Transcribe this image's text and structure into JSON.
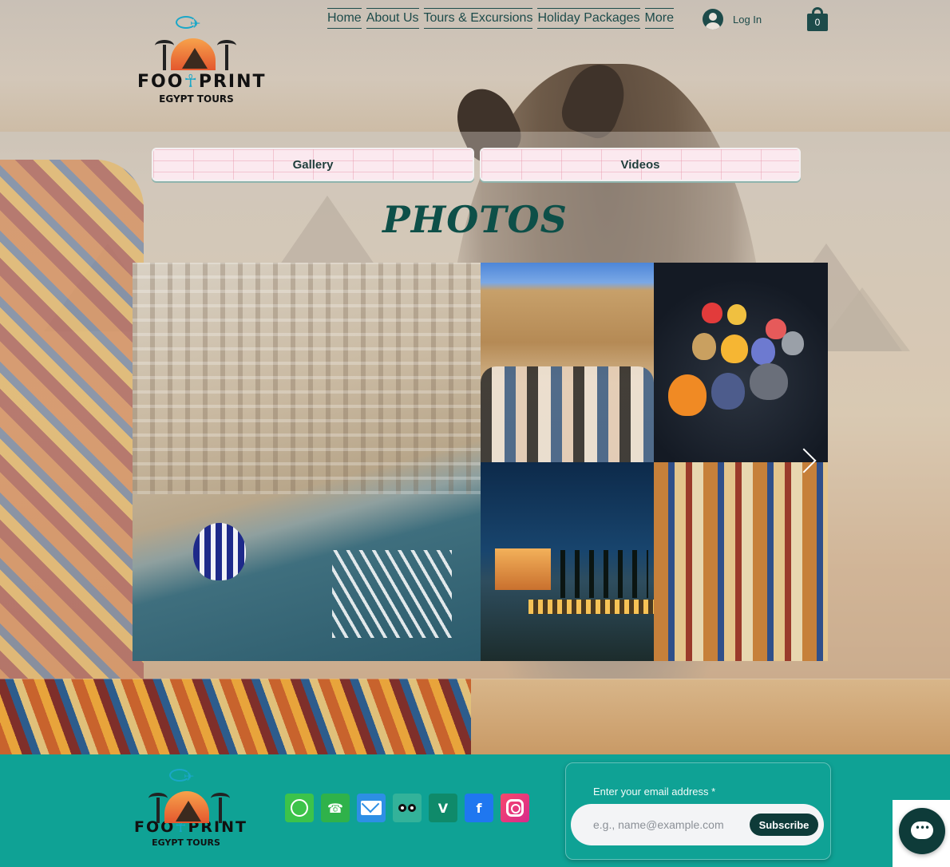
{
  "brand": {
    "name_pre": "FOO",
    "name_ankh": "☥",
    "name_post": "PRINT",
    "subtitle": "EGYPT TOURS"
  },
  "nav": {
    "items": [
      {
        "label": "Home"
      },
      {
        "label": "About Us"
      },
      {
        "label": "Tours & Excursions"
      },
      {
        "label": "Holiday Packages"
      },
      {
        "label": "More"
      }
    ],
    "login_label": "Log In",
    "cart_count": "0"
  },
  "main": {
    "tabs": [
      {
        "label": "Gallery"
      },
      {
        "label": "Videos"
      }
    ],
    "title": "PHOTOS"
  },
  "footer": {
    "brand": {
      "name_pre": "FOO",
      "name_ankh": "☥",
      "name_post": "PRINT",
      "subtitle": "EGYPT TOURS"
    },
    "social_icons": [
      "whatsapp-icon",
      "phone-icon",
      "mail-icon",
      "tripadvisor-icon",
      "viator-icon",
      "facebook-icon",
      "instagram-icon"
    ],
    "subscribe": {
      "label": "Enter your email address *",
      "placeholder": "e.g., name@example.com",
      "button": "Subscribe"
    }
  },
  "colors": {
    "accent": "#1d4b4a",
    "footer_bg": "#0fa295",
    "title": "#0d4f48",
    "button_dark": "#0e3b39"
  }
}
